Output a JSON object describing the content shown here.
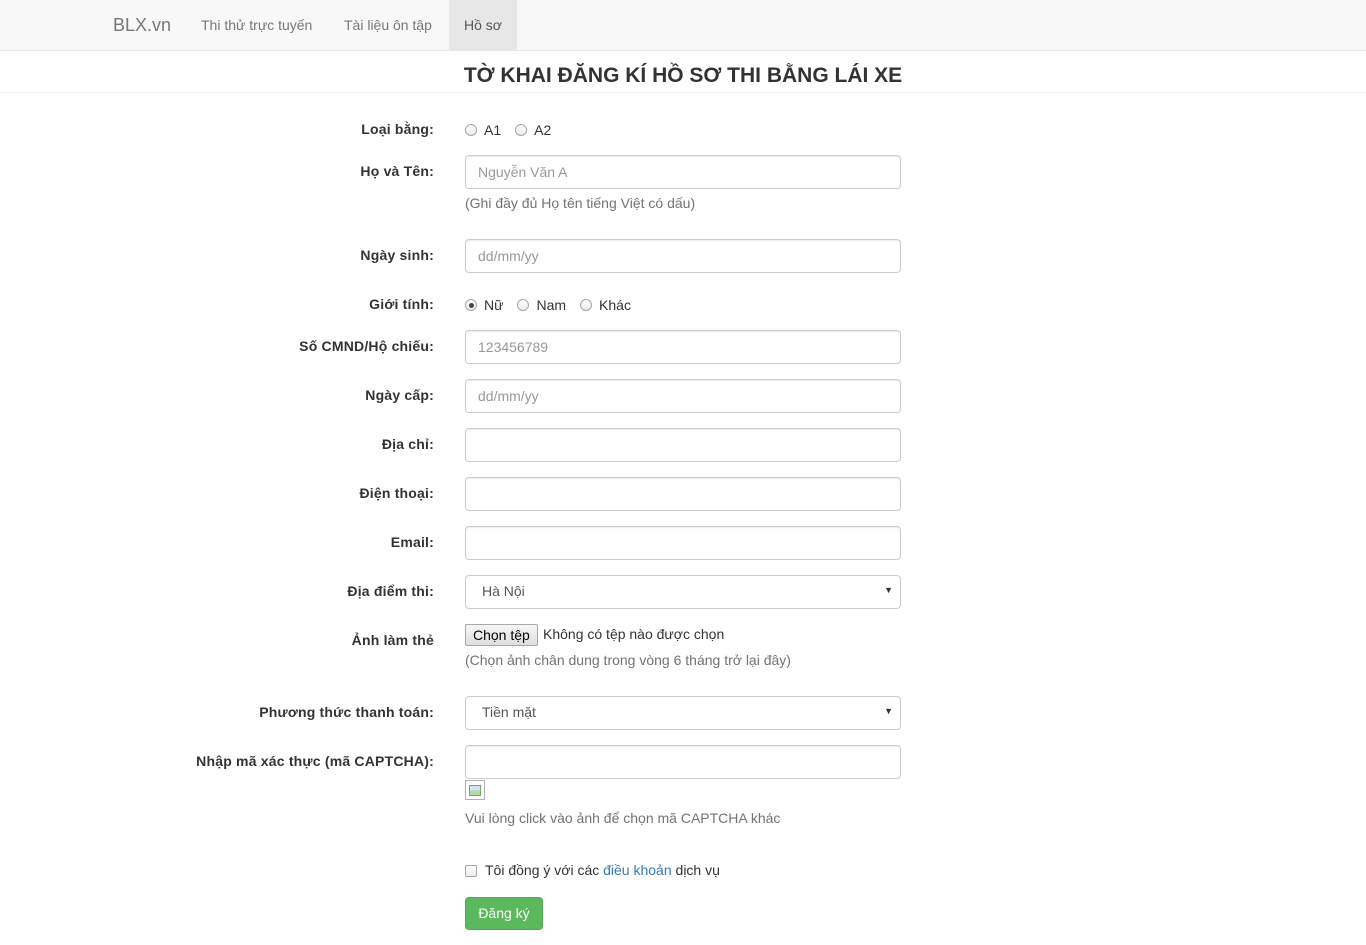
{
  "navbar": {
    "brand": "BLX.vn",
    "items": [
      {
        "label": "Thi thử trực tuyến",
        "active": false
      },
      {
        "label": "Tài liệu ôn tập",
        "active": false
      },
      {
        "label": "Hồ sơ",
        "active": true
      }
    ]
  },
  "page_title": "TỜ KHAI ĐĂNG KÍ HỒ SƠ THI BẰNG LÁI XE",
  "form": {
    "license_type": {
      "label": "Loại bằng:",
      "options": [
        "A1",
        "A2"
      ]
    },
    "full_name": {
      "label": "Họ và Tên:",
      "placeholder": "Nguyễn Văn A",
      "help": "(Ghi đầy đủ Họ tên tiếng Việt có dấu)"
    },
    "birth_date": {
      "label": "Ngày sinh:",
      "placeholder": "dd/mm/yy"
    },
    "gender": {
      "label": "Giới tính:",
      "options": [
        "Nữ",
        "Nam",
        "Khác"
      ],
      "selected": "Nữ"
    },
    "id_number": {
      "label": "Số CMND/Hộ chiếu:",
      "placeholder": "123456789"
    },
    "issue_date": {
      "label": "Ngày cấp:",
      "placeholder": "dd/mm/yy"
    },
    "address": {
      "label": "Địa chỉ:",
      "placeholder": ""
    },
    "phone": {
      "label": "Điện thoại:",
      "placeholder": ""
    },
    "email": {
      "label": "Email:",
      "placeholder": ""
    },
    "exam_location": {
      "label": "Địa điểm thi:",
      "value": "Hà Nội"
    },
    "photo": {
      "label": "Ảnh làm thẻ",
      "button": "Chọn tệp",
      "status": "Không có tệp nào được chọn",
      "help": "(Chọn ảnh chân dung trong vòng 6 tháng trở lại đây)"
    },
    "payment": {
      "label": "Phương thức thanh toán:",
      "value": "Tiền mặt"
    },
    "captcha": {
      "label": "Nhập mã xác thực (mã CAPTCHA):",
      "help": "Vui lòng click vào ảnh để chọn mã CAPTCHA khác"
    },
    "agree": {
      "prefix": "Tôi đồng ý với các ",
      "link": "điều khoản",
      "suffix": " dịch vụ"
    },
    "submit_label": "Đăng ký"
  }
}
